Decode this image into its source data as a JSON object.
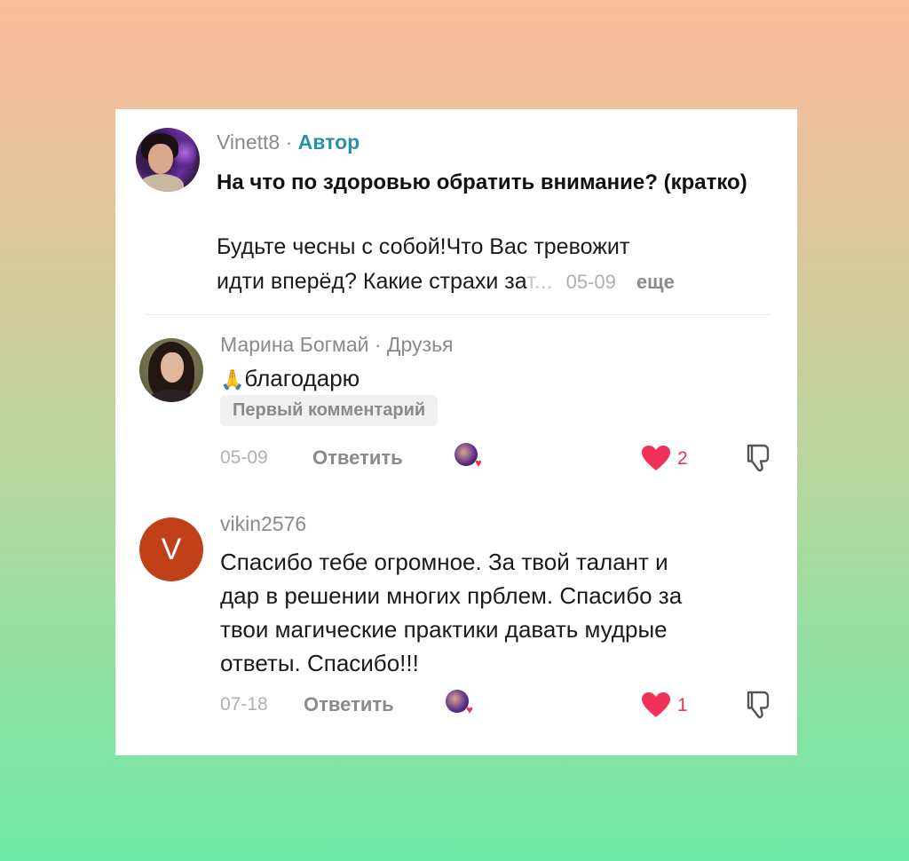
{
  "post": {
    "author": "Vinett8",
    "separator": " · ",
    "author_badge": "Автор",
    "title": "На что по здоровью обратить внимание? (кратко)",
    "body_line1": "Будьте чесны с собой!Что Вас тревожит",
    "body_line2_visible": "идти вперёд? Какие страхи за",
    "body_line2_faded": "т...",
    "date": "05-09",
    "more_label": "еще",
    "avatar_icon": "author-avatar"
  },
  "comments": [
    {
      "author": "Марина Богмай",
      "separator": " · ",
      "badge": "Друзья",
      "emoji": "🙏",
      "text": "благодарю",
      "tag": "Первый комментарий",
      "date": "05-09",
      "reply_label": "Ответить",
      "likes": "2",
      "liked": true
    },
    {
      "author": "vikin2576",
      "avatar_letter": "V",
      "text_lines": [
        "Спасибо тебе огромное. За твой талант и",
        "дар в решении многих прблем. Спасибо за",
        "твои магические практики давать мудрые",
        "ответы. Спасибо!!!"
      ],
      "date": "07-18",
      "reply_label": "Ответить",
      "likes": "1",
      "liked": true
    }
  ],
  "colors": {
    "accent_author": "#2a8fa8",
    "like_red": "#f0325a",
    "avatar_v_bg": "#c0401a"
  }
}
